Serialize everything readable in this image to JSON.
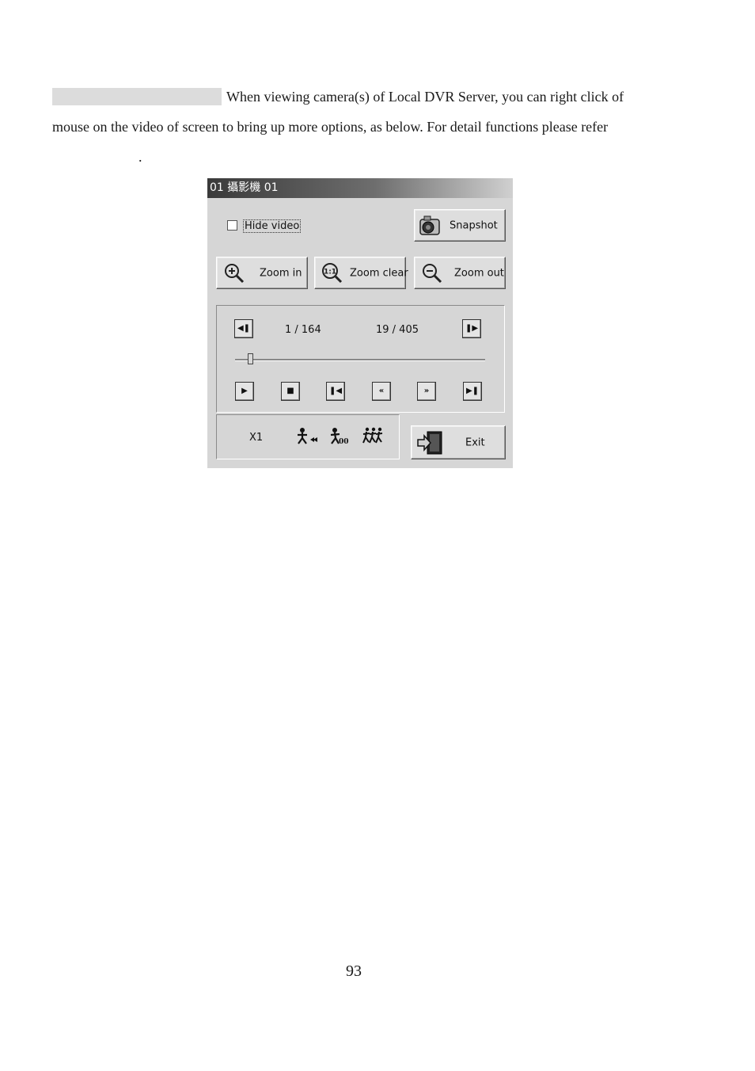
{
  "document": {
    "line1": "When viewing camera(s) of Local DVR Server, you can right click of",
    "line2": "mouse on the video of screen to bring up more options, as below.    For detail functions please refer",
    "line3": ".",
    "page_number": "93"
  },
  "dialog": {
    "title": "01 攝影機 01",
    "hide_video_label": "Hide video",
    "hide_video_checked": false,
    "snapshot_label": "Snapshot",
    "zoom_in_label": "Zoom in",
    "zoom_clear_label": "Zoom clear",
    "zoom_out_label": "Zoom out",
    "frame_counter_left": "1 / 164",
    "frame_counter_right": "19 / 405",
    "playback_position": 0.06,
    "speed_label": "X1",
    "exit_label": "Exit",
    "icons": {
      "prev_frame": "step-back-icon",
      "next_frame": "step-forward-icon",
      "play": "play-icon",
      "stop": "stop-icon",
      "first": "skip-first-icon",
      "rewind": "rewind-icon",
      "fast_forward": "fast-forward-icon",
      "last": "skip-last-icon",
      "slow": "slow-walker-icon",
      "normal": "walker-icon",
      "fast": "runners-icon",
      "snapshot": "camera-icon",
      "zoom_in": "zoom-in-icon",
      "zoom_clear": "zoom-reset-icon",
      "zoom_out": "zoom-out-icon",
      "exit": "exit-door-icon"
    }
  }
}
